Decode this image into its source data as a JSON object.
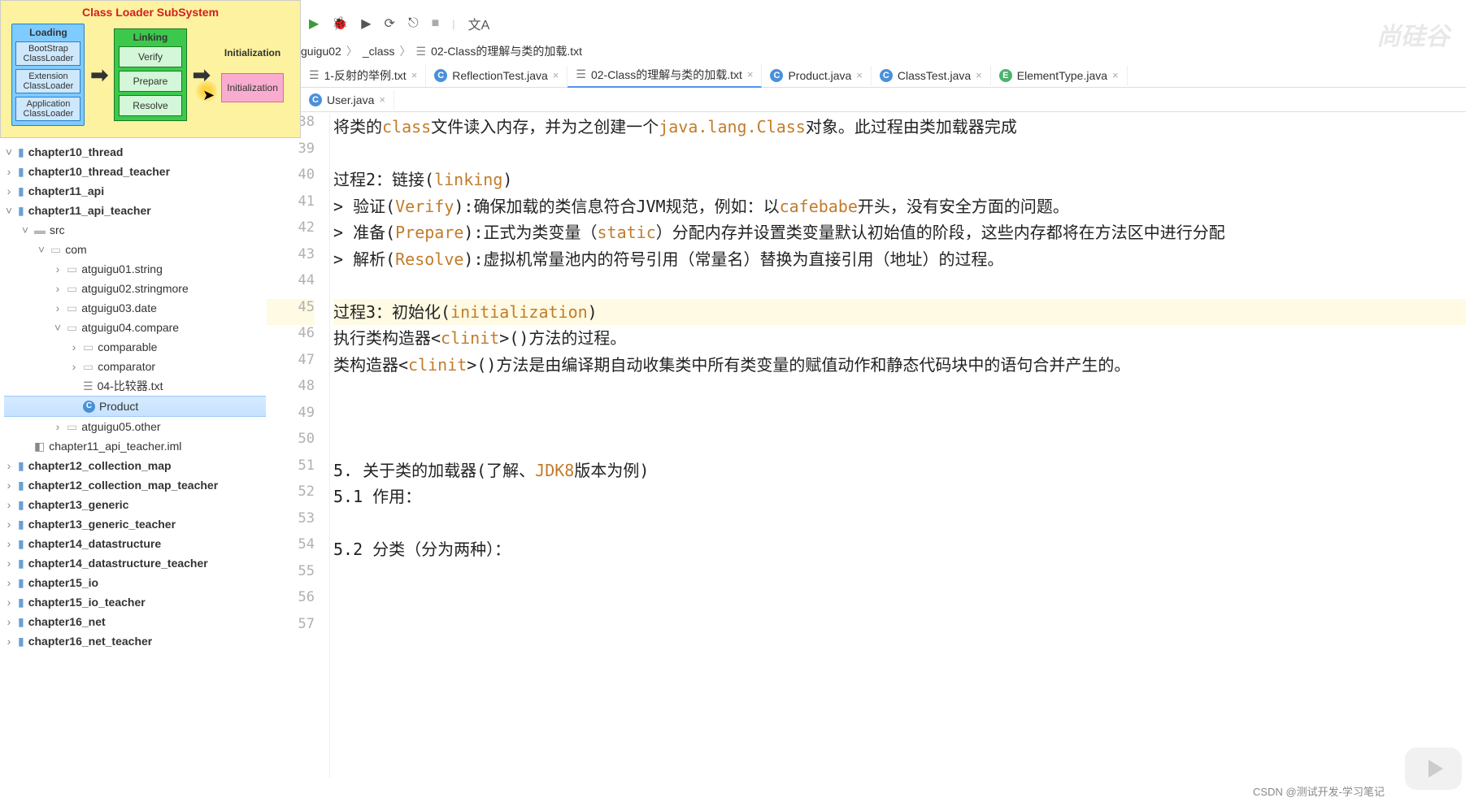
{
  "diagram": {
    "title": "Class Loader SubSystem",
    "loading": {
      "header": "Loading",
      "items": [
        "BootStrap ClassLoader",
        "Extension ClassLoader",
        "Application ClassLoader"
      ]
    },
    "linking": {
      "header": "Linking",
      "items": [
        "Verify",
        "Prepare",
        "Resolve"
      ]
    },
    "init": {
      "header": "Initialization",
      "box": "Initialization"
    }
  },
  "toolbar": {
    "run": "▶",
    "bug": "🐞",
    "cover": "▶",
    "profile": "⟳",
    "attach": "⎋",
    "stop": "■",
    "translate": "文A"
  },
  "breadcrumb": {
    "p1": "guigu02",
    "p2": "_class",
    "p3": "02-Class的理解与类的加载.txt"
  },
  "tabs1": [
    {
      "icon": "txt",
      "label": "1-反射的举例.txt"
    },
    {
      "icon": "c",
      "label": "ReflectionTest.java"
    },
    {
      "icon": "txt",
      "label": "02-Class的理解与类的加载.txt",
      "active": true
    },
    {
      "icon": "c",
      "label": "Product.java"
    },
    {
      "icon": "c",
      "label": "ClassTest.java"
    },
    {
      "icon": "e",
      "label": "ElementType.java"
    }
  ],
  "tabs2": [
    {
      "icon": "c",
      "label": "User.java"
    }
  ],
  "tree": [
    {
      "d": 1,
      "a": "v",
      "i": "mod",
      "t": "chapter10_thread"
    },
    {
      "d": 1,
      "a": ">",
      "i": "mod",
      "t": "chapter10_thread_teacher"
    },
    {
      "d": 1,
      "a": ">",
      "i": "mod",
      "t": "chapter11_api"
    },
    {
      "d": 1,
      "a": "v",
      "i": "mod",
      "t": "chapter11_api_teacher"
    },
    {
      "d": 2,
      "a": "v",
      "i": "dir",
      "t": "src"
    },
    {
      "d": 3,
      "a": "v",
      "i": "pkg",
      "t": "com"
    },
    {
      "d": 4,
      "a": ">",
      "i": "pkg",
      "t": "atguigu01.string"
    },
    {
      "d": 4,
      "a": ">",
      "i": "pkg",
      "t": "atguigu02.stringmore"
    },
    {
      "d": 4,
      "a": ">",
      "i": "pkg",
      "t": "atguigu03.date"
    },
    {
      "d": 4,
      "a": "v",
      "i": "pkg",
      "t": "atguigu04.compare"
    },
    {
      "d": 5,
      "a": ">",
      "i": "pkg",
      "t": "comparable"
    },
    {
      "d": 5,
      "a": ">",
      "i": "pkg",
      "t": "comparator"
    },
    {
      "d": 5,
      "a": "",
      "i": "txt",
      "t": "04-比较器.txt"
    },
    {
      "d": 5,
      "a": "",
      "i": "c",
      "t": "Product",
      "sel": true
    },
    {
      "d": 4,
      "a": ">",
      "i": "pkg",
      "t": "atguigu05.other"
    },
    {
      "d": 2,
      "a": "",
      "i": "iml",
      "t": "chapter11_api_teacher.iml"
    },
    {
      "d": 1,
      "a": ">",
      "i": "mod",
      "t": "chapter12_collection_map"
    },
    {
      "d": 1,
      "a": ">",
      "i": "mod",
      "t": "chapter12_collection_map_teacher"
    },
    {
      "d": 1,
      "a": ">",
      "i": "mod",
      "t": "chapter13_generic"
    },
    {
      "d": 1,
      "a": ">",
      "i": "mod",
      "t": "chapter13_generic_teacher"
    },
    {
      "d": 1,
      "a": ">",
      "i": "mod",
      "t": "chapter14_datastructure"
    },
    {
      "d": 1,
      "a": ">",
      "i": "mod",
      "t": "chapter14_datastructure_teacher"
    },
    {
      "d": 1,
      "a": ">",
      "i": "mod",
      "t": "chapter15_io"
    },
    {
      "d": 1,
      "a": ">",
      "i": "mod",
      "t": "chapter15_io_teacher"
    },
    {
      "d": 1,
      "a": ">",
      "i": "mod",
      "t": "chapter16_net"
    },
    {
      "d": 1,
      "a": ">",
      "i": "mod",
      "t": "chapter16_net_teacher"
    }
  ],
  "lines": {
    "start": 38,
    "rows": [
      "将类的class文件读入内存，并为之创建一个java.lang.Class对象。此过程由类加载器完成",
      "",
      "过程2：链接(linking)",
      "> 验证(Verify):确保加载的类信息符合JVM规范，例如：以cafebabe开头，没有安全方面的问题。",
      "> 准备(Prepare):正式为类变量（static）分配内存并设置类变量默认初始值的阶段，这些内存都将在方法区中进行分配",
      "> 解析(Resolve):虚拟机常量池内的符号引用（常量名）替换为直接引用（地址）的过程。",
      "",
      "过程3：初始化(initialization)",
      "执行类构造器<clinit>()方法的过程。",
      "类构造器<clinit>()方法是由编译期自动收集类中所有类变量的赋值动作和静态代码块中的语句合并产生的。",
      "",
      "",
      "",
      "5. 关于类的加载器(了解、JDK8版本为例)",
      "5.1 作用：",
      "",
      "5.2 分类（分为两种）：",
      "",
      "",
      ""
    ],
    "highlight": 45
  },
  "watermark": "尚硅谷",
  "credit": "CSDN @测试开发-学习笔记"
}
